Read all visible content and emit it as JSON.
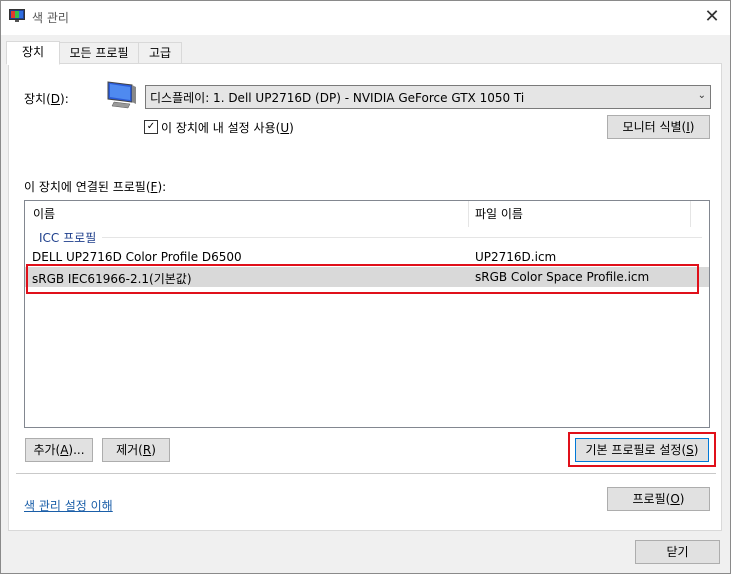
{
  "window": {
    "title": "색 관리",
    "close_glyph": "✕"
  },
  "tabs": [
    {
      "label": "장치"
    },
    {
      "label": "모든 프로필"
    },
    {
      "label": "고급"
    }
  ],
  "device": {
    "label_prefix": "장치(",
    "label_key": "D",
    "label_suffix": "):",
    "selected": "디스플레이: 1. Dell UP2716D (DP) - NVIDIA GeForce GTX 1050 Ti",
    "use_my_settings_prefix": "이 장치에 내 설정 사용(",
    "use_my_settings_key": "U",
    "use_my_settings_suffix": ")",
    "use_my_settings_checked": true,
    "identify_prefix": "모니터 식별(",
    "identify_key": "I",
    "identify_suffix": ")"
  },
  "profiles": {
    "label_prefix": "이 장치에 연결된 프로필(",
    "label_key": "F",
    "label_suffix": "):",
    "col_name": "이름",
    "col_file": "파일 이름",
    "group": "ICC 프로필",
    "rows": [
      {
        "name": "DELL UP2716D Color Profile D6500",
        "file": "UP2716D.icm"
      },
      {
        "name": "sRGB IEC61966-2.1(기본값)",
        "file": "sRGB Color Space Profile.icm"
      }
    ]
  },
  "buttons": {
    "add_prefix": "추가(",
    "add_key": "A",
    "add_suffix": ")...",
    "remove_prefix": "제거(",
    "remove_key": "R",
    "remove_suffix": ")",
    "set_default_prefix": "기본 프로필로 설정(",
    "set_default_key": "S",
    "set_default_suffix": ")",
    "profile_prefix": "프로필(",
    "profile_key": "O",
    "profile_suffix": ")",
    "close": "닫기"
  },
  "links": {
    "understand": "색 관리 설정 이해"
  },
  "colors": {
    "highlight": "#e0101a",
    "link": "#1a5ea8",
    "group": "#1e3f8c"
  }
}
